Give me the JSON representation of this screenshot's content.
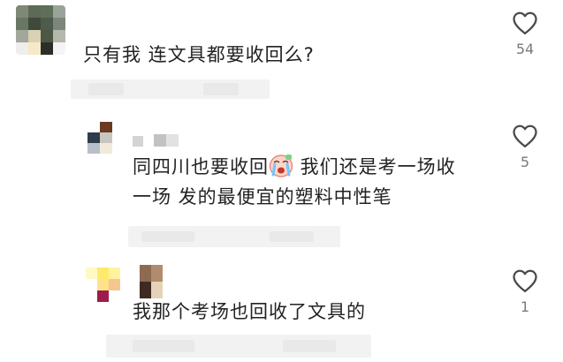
{
  "comments": [
    {
      "text": "只有我 连文具都要收回么?",
      "likes": "54",
      "replies": [
        {
          "text_part1": "同四川也要收回",
          "emoji": "crying-face-emoji",
          "text_part2": " 我们还是考一场收",
          "text_line2": "一场 发的最便宜的塑料中性笔",
          "likes": "5"
        },
        {
          "text": "我那个考场也回收了文具的",
          "likes": "1"
        }
      ]
    }
  ],
  "colors": {
    "text": "#222222",
    "like_count": "#7a7a7a",
    "heart_stroke": "#4a4a4a"
  }
}
